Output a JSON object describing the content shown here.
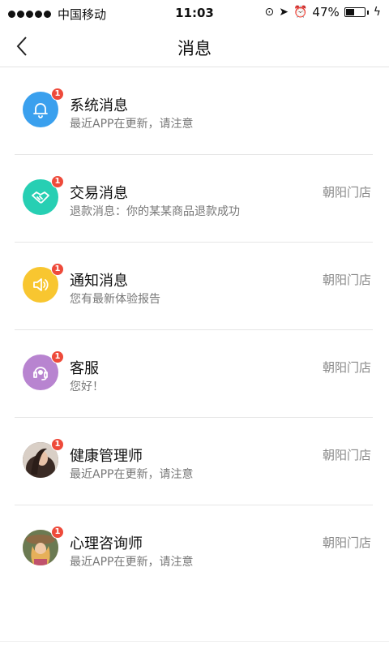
{
  "status_bar": {
    "carrier": "中国移动",
    "time": "11:03",
    "battery": "47%",
    "battery_level": 0.47
  },
  "nav": {
    "title": "消息"
  },
  "messages": [
    {
      "title": "系统消息",
      "subtitle": "最近APP在更新，请注意",
      "store": "",
      "badge": "1",
      "icon": "bell-icon",
      "color": "#3aa0ee"
    },
    {
      "title": "交易消息",
      "subtitle": "退款消息：你的某某商品退款成功",
      "store": "朝阳门店",
      "badge": "1",
      "icon": "handshake-icon",
      "color": "#27cfb3"
    },
    {
      "title": "通知消息",
      "subtitle": "您有最新体验报告",
      "store": "朝阳门店",
      "badge": "1",
      "icon": "speaker-icon",
      "color": "#f8c630"
    },
    {
      "title": "客服",
      "subtitle": "您好！",
      "store": "朝阳门店",
      "badge": "1",
      "icon": "headset-icon",
      "color": "#b884d0"
    },
    {
      "title": "健康管理师",
      "subtitle": "最近APP在更新，请注意",
      "store": "朝阳门店",
      "badge": "1",
      "icon": "person-photo",
      "color": "#5a4a44"
    },
    {
      "title": "心理咨询师",
      "subtitle": "最近APP在更新，请注意",
      "store": "朝阳门店",
      "badge": "1",
      "icon": "person-photo",
      "color": "#c9a27a"
    }
  ]
}
